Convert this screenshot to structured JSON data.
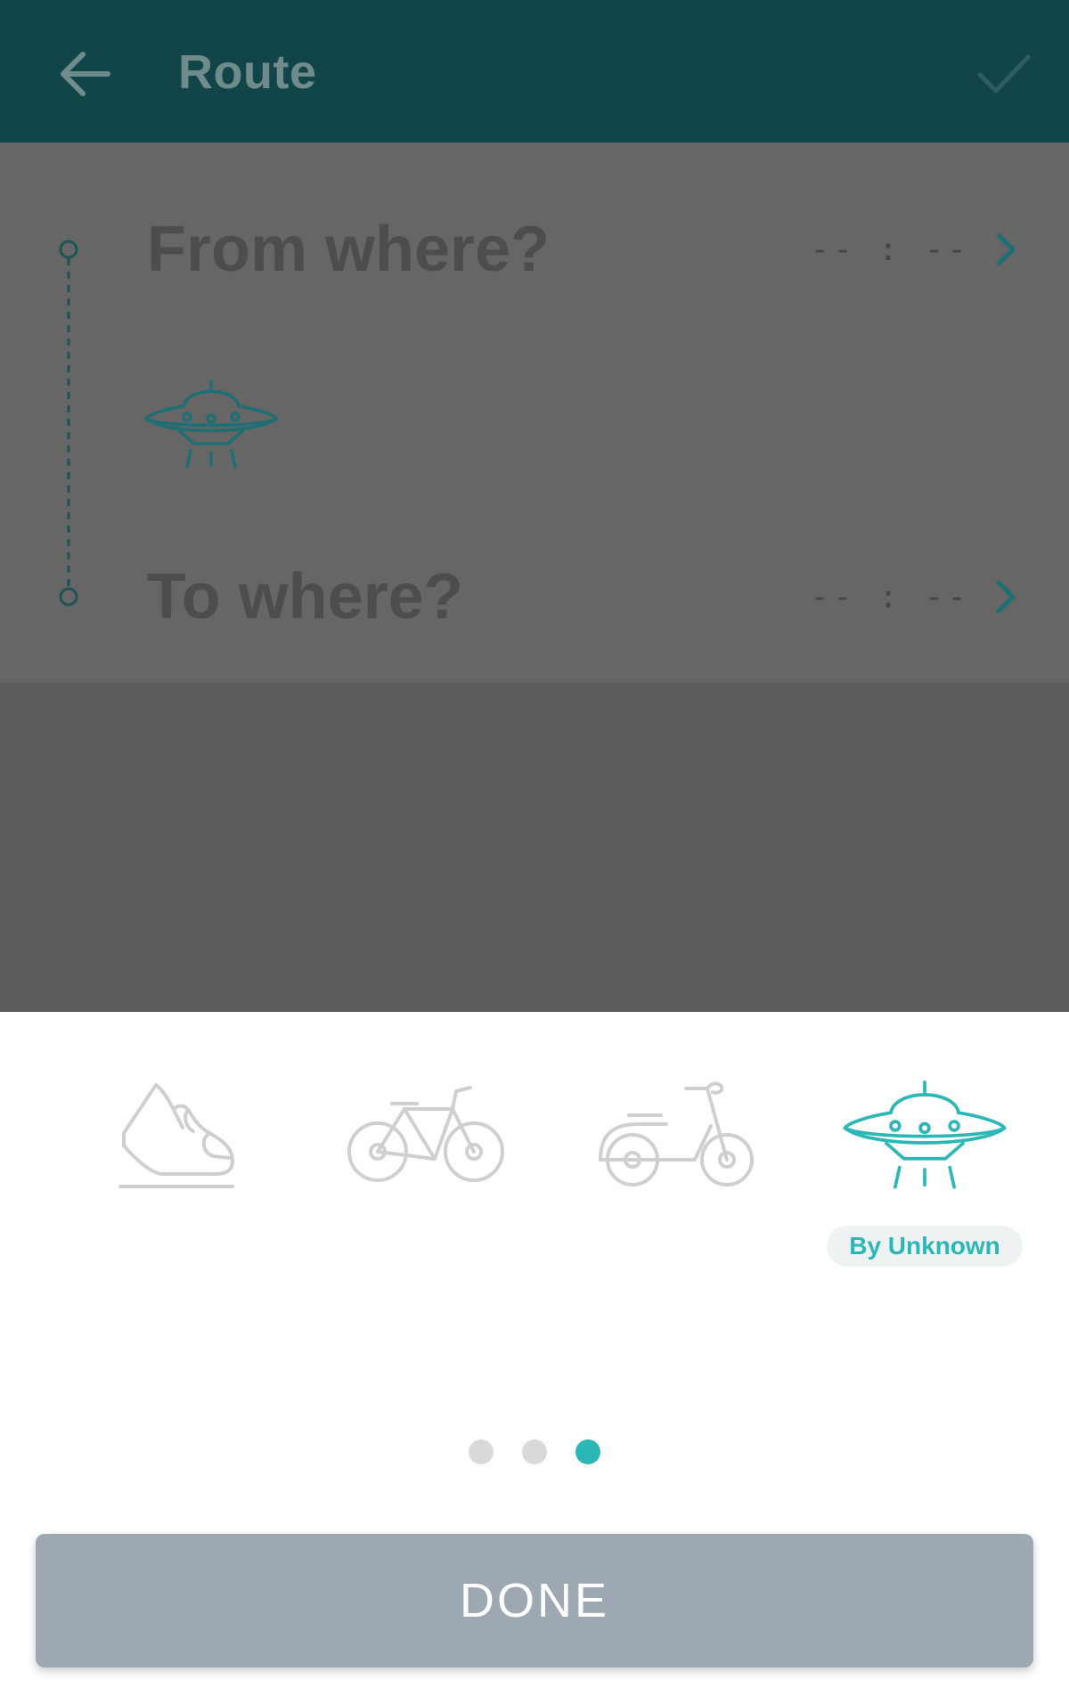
{
  "appbar": {
    "title": "Route",
    "back_icon": "arrow-left-icon",
    "confirm_icon": "check-icon"
  },
  "route": {
    "from": {
      "label": "From where?",
      "time": "-- : --"
    },
    "to": {
      "label": "To where?",
      "time": "-- : --"
    },
    "selected_mode_icon": "ufo-icon"
  },
  "transport_modes": [
    {
      "icon": "shoe-icon",
      "selected": false
    },
    {
      "icon": "bicycle-icon",
      "selected": false
    },
    {
      "icon": "scooter-icon",
      "selected": false
    },
    {
      "icon": "ufo-icon",
      "selected": true,
      "label": "By Unknown"
    }
  ],
  "pager": {
    "pages": 3,
    "current": 3
  },
  "done_label": "DONE",
  "colors": {
    "accent": "#2bb7b6",
    "appbar": "#12454a",
    "done_button": "#9ea8b3",
    "inactive_icon": "#cfcfcf"
  }
}
